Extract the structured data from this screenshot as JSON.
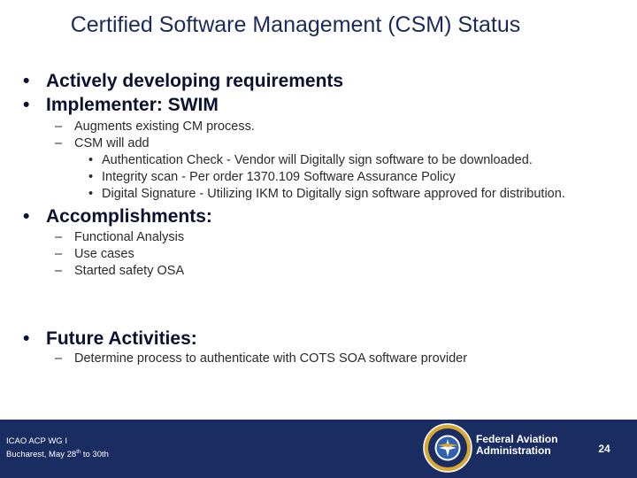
{
  "slide": {
    "title": "Certified Software Management (CSM) Status",
    "bullet_glyph": "•",
    "dash_glyph": "–",
    "items": [
      {
        "text": "Actively developing requirements"
      },
      {
        "text": "Implementer: SWIM"
      },
      {
        "text": "Augments existing CM process."
      },
      {
        "text": "CSM will add"
      },
      {
        "text": "Authentication Check - Vendor will Digitally sign software to be downloaded."
      },
      {
        "text": "Integrity scan - Per order 1370.109 Software Assurance Policy"
      },
      {
        "text": "Digital Signature - Utilizing IKM to Digitally sign software approved for distribution."
      },
      {
        "text": "Accomplishments:"
      },
      {
        "text": "Functional Analysis"
      },
      {
        "text": "Use cases"
      },
      {
        "text": "Started safety OSA"
      },
      {
        "text": "Future Activities:"
      },
      {
        "text": "Determine process to authenticate with COTS SOA software provider"
      }
    ]
  },
  "footer": {
    "event_line1": "ICAO ACP WG I",
    "event_line2_prefix": "Bucharest, May 28",
    "event_line2_sup": "th",
    "event_line2_suffix": " to 30th",
    "agency_line1": "Federal Aviation",
    "agency_line2": "Administration",
    "page_number": "24",
    "seal_text": "FEDERAL AVIATION ADMINISTRATION",
    "bar_color": "#1a2d63"
  }
}
